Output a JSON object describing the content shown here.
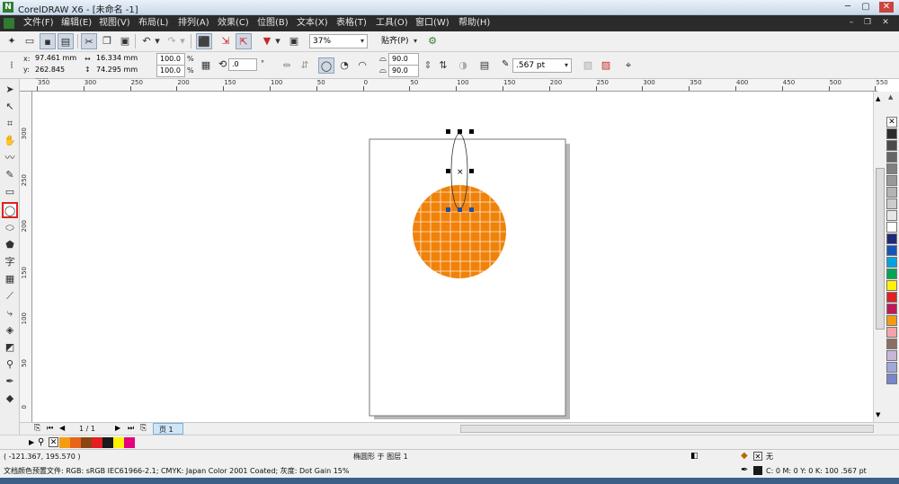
{
  "window": {
    "logo": "N",
    "title": "CorelDRAW X6 - [未命名 -1]",
    "controls": {
      "minimize": "─",
      "maximize": "▢",
      "close": "✕"
    }
  },
  "menu": {
    "items": [
      "文件(F)",
      "编辑(E)",
      "视图(V)",
      "布局(L)",
      "排列(A)",
      "效果(C)",
      "位图(B)",
      "文本(X)",
      "表格(T)",
      "工具(O)",
      "窗口(W)",
      "帮助(H)"
    ],
    "doc_controls": {
      "minimize": "–",
      "restore": "❐",
      "close": "✕"
    }
  },
  "standard_toolbar": {
    "zoom": "37%",
    "snap": "贴齐(P)"
  },
  "property_bar": {
    "x_label": "x:",
    "x_value": "97.461 mm",
    "y_label": "y:",
    "y_value": "262.845 mm",
    "width_value": "16.334 mm",
    "height_value": "74.295 mm",
    "scale_w": "100.0",
    "scale_h": "100.0",
    "percent": "%",
    "rotation": ".0",
    "degree": "°",
    "start_angle": "90.0",
    "end_angle": "90.0",
    "outline_width": ".567 pt"
  },
  "rulers": {
    "h_ticks": [
      "350",
      "300",
      "250",
      "200",
      "150",
      "100",
      "50",
      "0",
      "50",
      "100",
      "150",
      "200",
      "250",
      "300",
      "350",
      "400",
      "450",
      "500",
      "550"
    ],
    "v_ticks": [
      "300",
      "250",
      "200",
      "150",
      "100",
      "50",
      "0"
    ],
    "unit": "毫米"
  },
  "page_nav": {
    "page_count": "1 / 1",
    "page_tab": "页 1"
  },
  "status": {
    "cursor": "( -121.367, 195.570 )",
    "object_info": "椭圆形 于 图层 1",
    "fill_none_label": "无",
    "color_profile": "文档颜色预置文件: RGB: sRGB IEC61966-2.1; CMYK: Japan Color 2001 Coated; 灰度: Dot Gain 15%",
    "outline_info": "C: 0 M: 0 Y: 0 K: 100  .567 pt"
  },
  "colors": {
    "orange_fill": "#f0820a",
    "grid_line": "#ffffff",
    "page_shadow": "#b8b8b8",
    "selected_tool_border": "#e02020"
  },
  "palette_swatches": [
    "#ffffff",
    "#2d2d2d",
    "#4a4a4a",
    "#666666",
    "#808080",
    "#999999",
    "#b3b3b3",
    "#cccccc",
    "#e6e6e6",
    "#ffffff",
    "#1f2a7a",
    "#1456b8",
    "#00a3e0",
    "#00a651",
    "#fff200",
    "#e31e24",
    "#c2185b",
    "#f39c12",
    "#f4a3a8",
    "#8d6e63",
    "#c8b6d9",
    "#9fa8da",
    "#7986cb"
  ],
  "doc_palette": [
    "#f39c12",
    "#e8641a",
    "#8b4513",
    "#e31e24",
    "#1a1a1a",
    "#fff200",
    "#e4007f"
  ]
}
